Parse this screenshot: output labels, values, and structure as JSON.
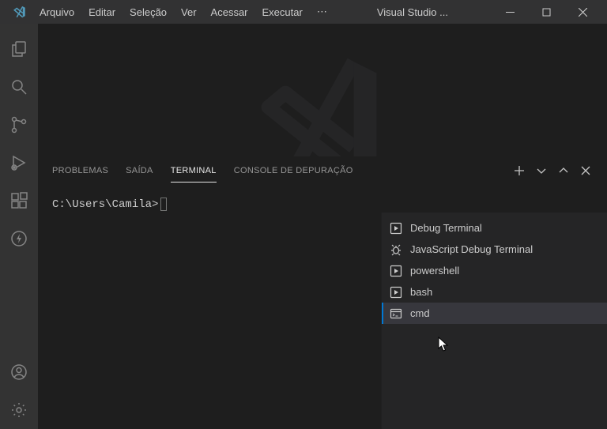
{
  "titlebar": {
    "app_title": "Visual Studio ...",
    "menu": [
      "Arquivo",
      "Editar",
      "Seleção",
      "Ver",
      "Acessar",
      "Executar"
    ],
    "ellipsis": "⋯"
  },
  "panel": {
    "tabs": {
      "problems": "PROBLEMAS",
      "output": "SAÍDA",
      "terminal": "TERMINAL",
      "debug_console": "CONSOLE DE DEPURAÇÃO"
    }
  },
  "terminal": {
    "prompt": "C:\\Users\\Camila>"
  },
  "terminal_menu": {
    "items": [
      {
        "label": "Debug Terminal",
        "icon": "play-box"
      },
      {
        "label": "JavaScript Debug Terminal",
        "icon": "bug"
      },
      {
        "label": "powershell",
        "icon": "play-box"
      },
      {
        "label": "bash",
        "icon": "play-box"
      },
      {
        "label": "cmd",
        "icon": "cmd",
        "selected": true
      }
    ]
  }
}
